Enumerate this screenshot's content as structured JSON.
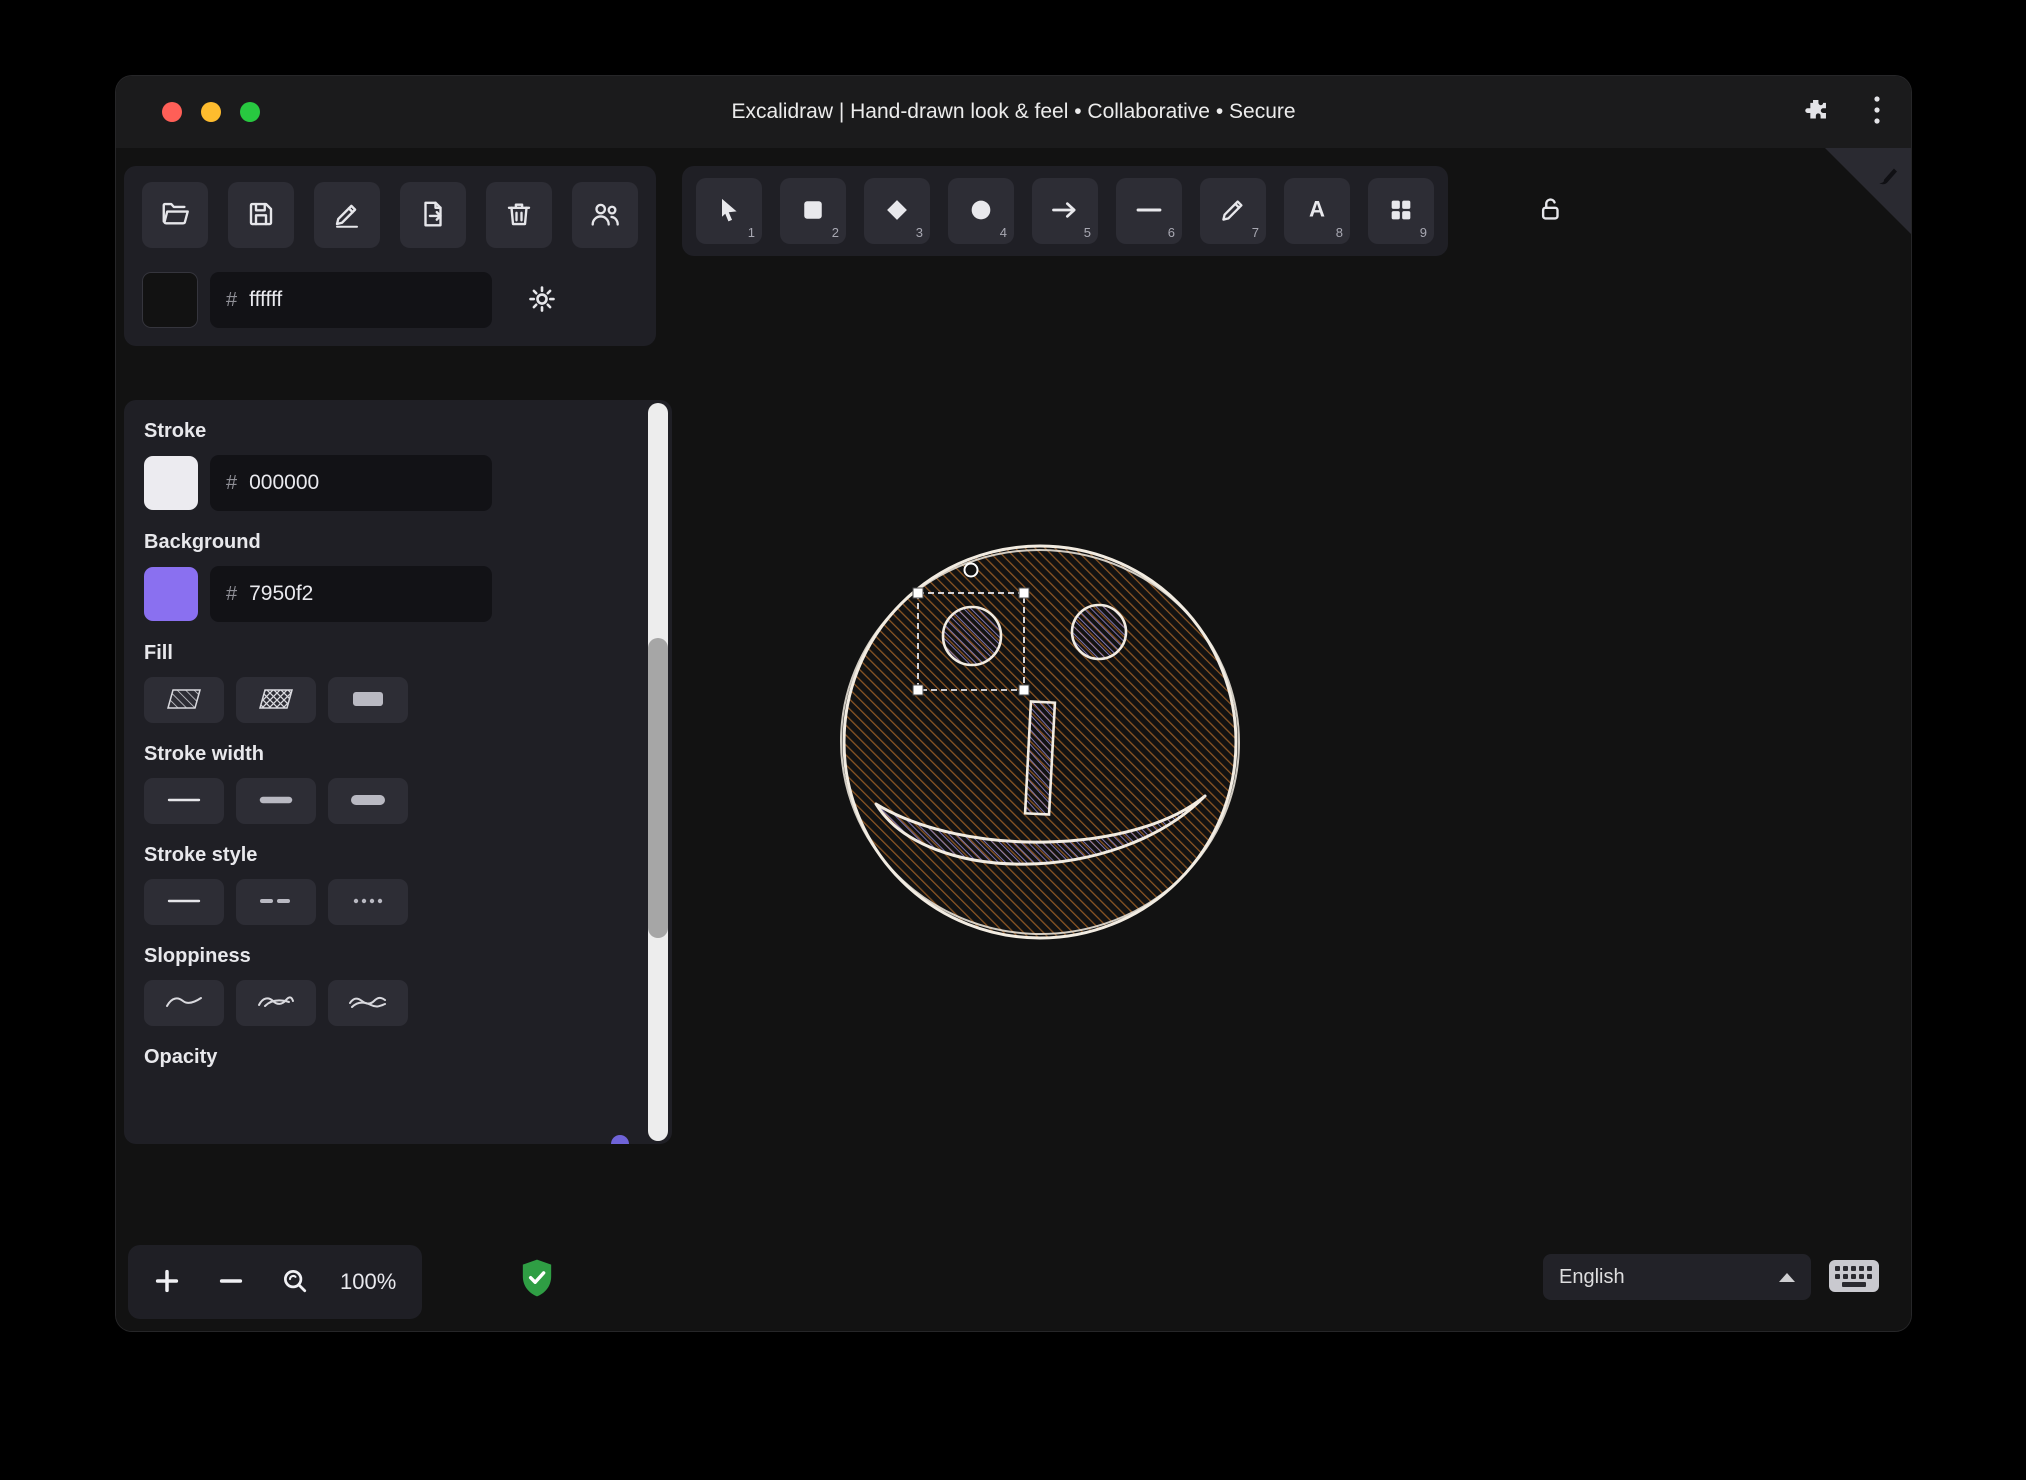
{
  "window": {
    "title": "Excalidraw | Hand-drawn look & feel • Collaborative • Secure",
    "controls": [
      "close",
      "minimize",
      "zoom"
    ]
  },
  "file_toolbar": {
    "buttons": [
      {
        "name": "load-scene"
      },
      {
        "name": "save"
      },
      {
        "name": "save-as"
      },
      {
        "name": "export"
      },
      {
        "name": "clear-canvas"
      },
      {
        "name": "collaborators"
      }
    ]
  },
  "canvas_background": {
    "hash": "#",
    "hex": "ffffff"
  },
  "tools": {
    "items": [
      {
        "num": "1",
        "name": "selection"
      },
      {
        "num": "2",
        "name": "rectangle"
      },
      {
        "num": "3",
        "name": "diamond"
      },
      {
        "num": "4",
        "name": "ellipse"
      },
      {
        "num": "5",
        "name": "arrow"
      },
      {
        "num": "6",
        "name": "line"
      },
      {
        "num": "7",
        "name": "draw"
      },
      {
        "num": "8",
        "name": "text",
        "glyph": "A"
      },
      {
        "num": "9",
        "name": "shapes"
      }
    ]
  },
  "panel": {
    "stroke": {
      "label": "Stroke",
      "hash": "#",
      "hex": "000000",
      "swatch": "#ecebf0"
    },
    "background": {
      "label": "Background",
      "hash": "#",
      "hex": "7950f2",
      "swatch": "#8a70f0"
    },
    "fill": {
      "label": "Fill",
      "options": [
        "hachure",
        "cross-hatch",
        "solid"
      ]
    },
    "stroke_width": {
      "label": "Stroke width",
      "options": [
        "thin",
        "bold",
        "extra-bold"
      ]
    },
    "stroke_style": {
      "label": "Stroke style",
      "options": [
        "solid",
        "dashed",
        "dotted"
      ]
    },
    "sloppiness": {
      "label": "Sloppiness",
      "options": [
        "architect",
        "artist",
        "cartoonist"
      ]
    },
    "opacity": {
      "label": "Opacity"
    }
  },
  "footer": {
    "zoom_level": "100%",
    "language": "English"
  },
  "colors": {
    "accent": "#7950f2",
    "canvas_bg": "#121212",
    "island_bg": "#1f1f25",
    "button_bg": "#2d2d35",
    "shield_green": "#2f9e44",
    "face_hatch": "#8a5524",
    "feature_hatch": "#8d84c9"
  }
}
